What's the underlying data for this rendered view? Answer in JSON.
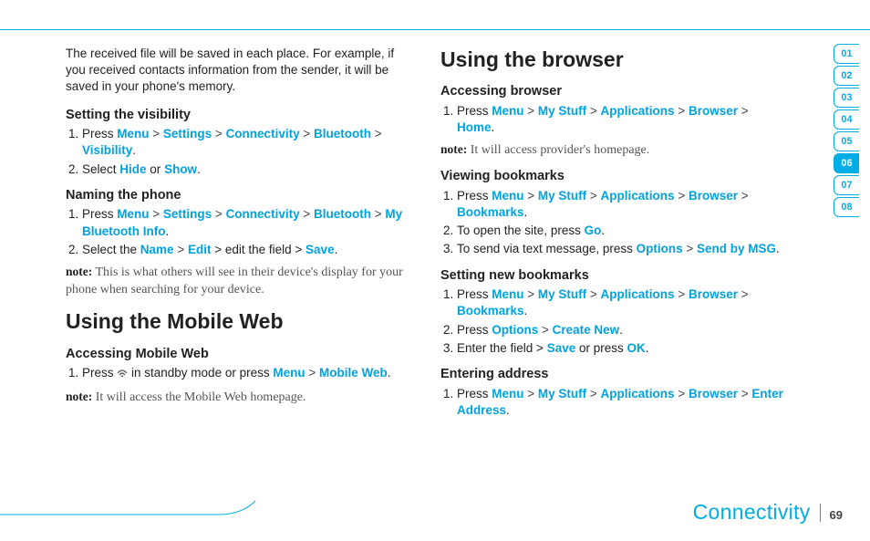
{
  "intro": "The received file will be saved in each place. For example, if you received contacts information from the sender, it will be saved in your phone's memory.",
  "vis": {
    "heading": "Setting the visibility",
    "press": "Press ",
    "menu": "Menu",
    "settings": "Settings",
    "connectivity": "Connectivity",
    "bluetooth": "Bluetooth",
    "visibility": "Visibility",
    "select": "Select ",
    "hide": "Hide",
    "or": " or ",
    "show": "Show"
  },
  "naming": {
    "heading": "Naming the phone",
    "press": "Press ",
    "menu": "Menu",
    "settings": "Settings",
    "connectivity": "Connectivity",
    "bluetooth": "Bluetooth",
    "mybt": "My Bluetooth Info",
    "select_the": "Select the ",
    "name": "Name",
    "edit": "Edit",
    "edit_field": " > edit the field > ",
    "save": "Save",
    "note_label": "note:",
    "note_text": " This is what others will see in their device's display for your phone when searching for your device."
  },
  "mobile_web": {
    "heading": "Using the Mobile Web",
    "access_heading": "Accessing Mobile Web",
    "press": "Press ",
    "standby": " in standby mode or press ",
    "menu": "Menu",
    "mw": "Mobile Web",
    "note_label": "note:",
    "note_text": " It will access the Mobile Web homepage."
  },
  "browser": {
    "heading": "Using the browser",
    "access_heading": "Accessing browser",
    "press": "Press ",
    "menu": "Menu",
    "mystuff": "My Stuff",
    "apps": "Applications",
    "browser_kw": "Browser",
    "home": "Home",
    "note_label": "note:",
    "note_text": " It will access provider's homepage."
  },
  "bookmarks": {
    "heading": "Viewing bookmarks",
    "press": "Press ",
    "menu": "Menu",
    "mystuff": "My Stuff",
    "apps": "Applications",
    "browser_kw": "Browser",
    "bm": "Bookmarks",
    "open": "To open the site, press ",
    "go": "Go",
    "send": "To send via text message, press ",
    "options": "Options",
    "sendmsg": "Send by MSG"
  },
  "newbm": {
    "heading": "Setting new bookmarks",
    "press": "Press ",
    "menu": "Menu",
    "mystuff": "My Stuff",
    "apps": "Applications",
    "browser_kw": "Browser",
    "bm": "Bookmarks",
    "press2": "Press ",
    "options": "Options",
    "create": "Create New",
    "enter": "Enter the field > ",
    "save": "Save",
    "orpress": " or press ",
    "ok": "OK"
  },
  "enter_addr": {
    "heading": "Entering address",
    "press": "Press ",
    "menu": "Menu",
    "mystuff": "My Stuff",
    "apps": "Applications",
    "browser_kw": "Browser",
    "ea": "Enter Address"
  },
  "tabs": [
    "01",
    "02",
    "03",
    "04",
    "05",
    "06",
    "07",
    "08"
  ],
  "active_tab": "06",
  "footer_title": "Connectivity",
  "page_number": "69"
}
